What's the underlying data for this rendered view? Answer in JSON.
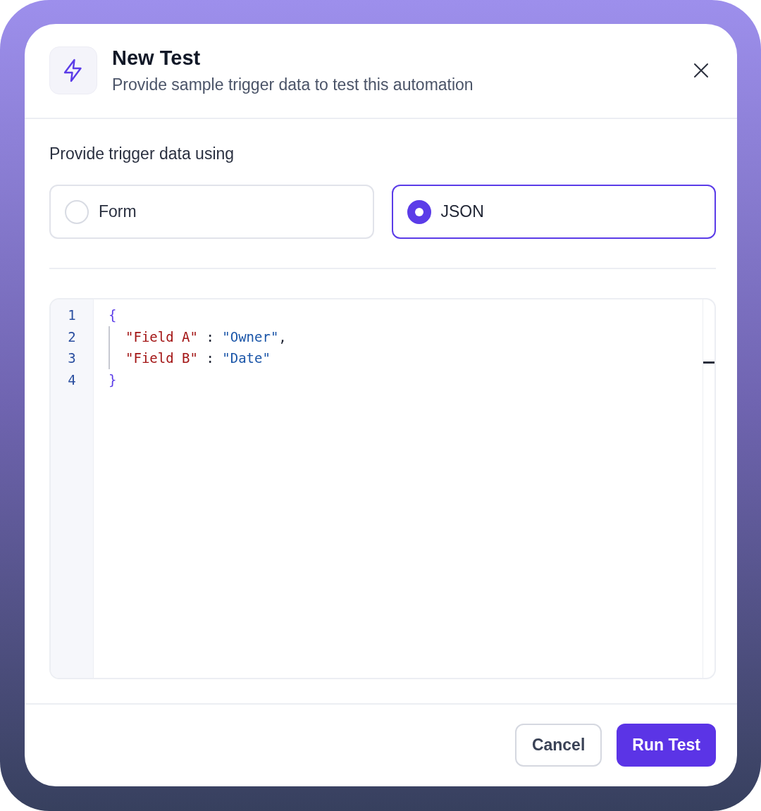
{
  "dialog": {
    "title": "New Test",
    "subtitle": "Provide sample trigger data to test this automation"
  },
  "section_label": "Provide trigger data using",
  "options": [
    {
      "label": "Form",
      "selected": false
    },
    {
      "label": "JSON",
      "selected": true
    }
  ],
  "editor": {
    "lines": [
      {
        "number": "1",
        "indented": false,
        "tokens": [
          {
            "kind": "brace",
            "text": "{"
          }
        ]
      },
      {
        "number": "2",
        "indented": true,
        "tokens": [
          {
            "kind": "key",
            "text": "\"Field A\""
          },
          {
            "kind": "punct",
            "text": " : "
          },
          {
            "kind": "string",
            "text": "\"Owner\""
          },
          {
            "kind": "punct",
            "text": ","
          }
        ]
      },
      {
        "number": "3",
        "indented": true,
        "tokens": [
          {
            "kind": "key",
            "text": "\"Field B\""
          },
          {
            "kind": "punct",
            "text": " : "
          },
          {
            "kind": "string",
            "text": "\"Date\""
          }
        ]
      },
      {
        "number": "4",
        "indented": false,
        "tokens": [
          {
            "kind": "brace",
            "text": "}"
          }
        ]
      }
    ]
  },
  "buttons": [
    {
      "label": "Cancel",
      "kind": "secondary"
    },
    {
      "label": "Run Test",
      "kind": "primary"
    }
  ]
}
